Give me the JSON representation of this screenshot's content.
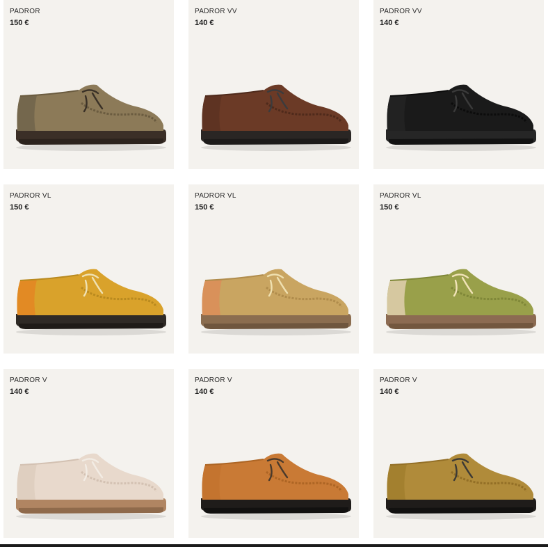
{
  "products": [
    {
      "name": "PADROR",
      "price": "150 €",
      "colors": {
        "upper": "#8c7a58",
        "upperDark": "#6b5c40",
        "heel": "#74674d",
        "sole": "#3b2f27",
        "solePad": "#2c231d",
        "lace": "#3a3127"
      }
    },
    {
      "name": "PADROR VV",
      "price": "140 €",
      "colors": {
        "upper": "#6b3a26",
        "upperDark": "#4f2a1b",
        "heel": "#5e3322",
        "sole": "#2a2624",
        "solePad": "#1c1a19",
        "lace": "#3b3b3d"
      }
    },
    {
      "name": "PADROR VV",
      "price": "140 €",
      "colors": {
        "upper": "#1a1a1a",
        "upperDark": "#0c0c0c",
        "heel": "#222222",
        "sole": "#262626",
        "solePad": "#121212",
        "lace": "#3a3a3a"
      }
    },
    {
      "name": "PADROR VL",
      "price": "150 €",
      "colors": {
        "upper": "#d9a22b",
        "upperDark": "#b98a1f",
        "heel": "#e28a24",
        "sole": "#2f2a26",
        "solePad": "#1f1b18",
        "lace": "#efe1b3"
      }
    },
    {
      "name": "PADROR VL",
      "price": "150 €",
      "colors": {
        "upper": "#c9a561",
        "upperDark": "#b08c4c",
        "heel": "#d9915a",
        "sole": "#8b6d4f",
        "solePad": "#6f563e",
        "lace": "#efe0b0"
      }
    },
    {
      "name": "PADROR VL",
      "price": "150 €",
      "colors": {
        "upper": "#99a04a",
        "upperDark": "#7f8738",
        "heel": "#d6c8a0",
        "sole": "#8c6b52",
        "solePad": "#73573f",
        "lace": "#f1e3b8"
      }
    },
    {
      "name": "PADROR V",
      "price": "140 €",
      "colors": {
        "upper": "#e8d9cc",
        "upperDark": "#d3c1b2",
        "heel": "#dfcfc0",
        "sole": "#b08562",
        "solePad": "#8f6a4b",
        "lace": "#f2ece4"
      }
    },
    {
      "name": "PADROR V",
      "price": "140 €",
      "colors": {
        "upper": "#c97a35",
        "upperDark": "#ad6524",
        "heel": "#c4742f",
        "sole": "#1f1c1a",
        "solePad": "#121110",
        "lace": "#4a3a2c"
      }
    },
    {
      "name": "PADROR V",
      "price": "140 €",
      "colors": {
        "upper": "#b08b3a",
        "upperDark": "#936f26",
        "heel": "#a3802f",
        "sole": "#1f1c1a",
        "solePad": "#121110",
        "lace": "#3c3a36"
      }
    }
  ]
}
